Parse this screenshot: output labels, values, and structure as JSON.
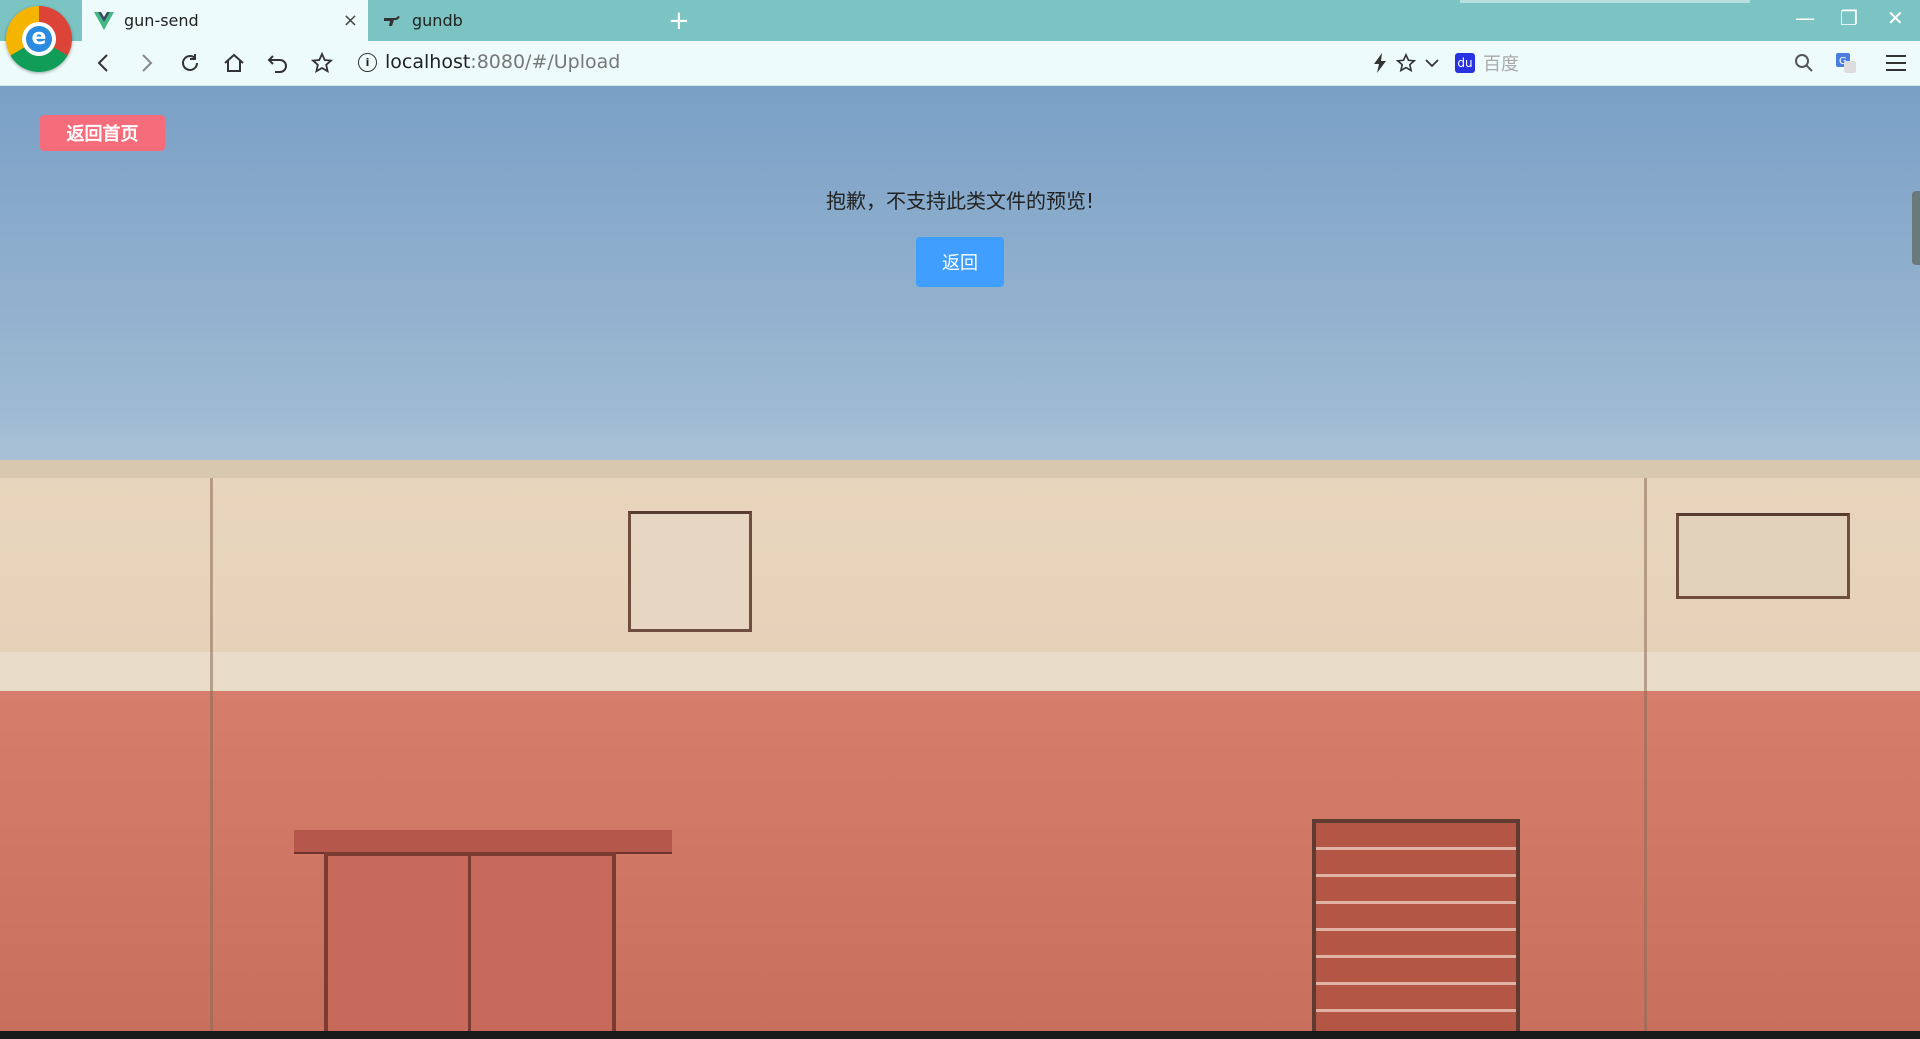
{
  "browser": {
    "tabs": [
      {
        "title": "gun-send",
        "active": true
      },
      {
        "title": "gundb",
        "active": false
      }
    ],
    "new_tab_symbol": "+",
    "close_symbol": "×",
    "window_controls": {
      "minimize": "—",
      "restore": "❐",
      "close": "✕"
    },
    "address": {
      "host": "localhost",
      "rest": ":8080/#/Upload"
    },
    "search": {
      "engine_icon": "baidu-icon",
      "placeholder": "百度"
    },
    "colors": {
      "tabbar": "#7bc4c3",
      "toolbar": "#eefbfb"
    }
  },
  "page": {
    "home_button_label": "返回首页",
    "message": "抱歉，不支持此类文件的预览!",
    "back_button_label": "返回",
    "colors": {
      "home_button": "#f56c7b",
      "back_button": "#409eff"
    }
  }
}
